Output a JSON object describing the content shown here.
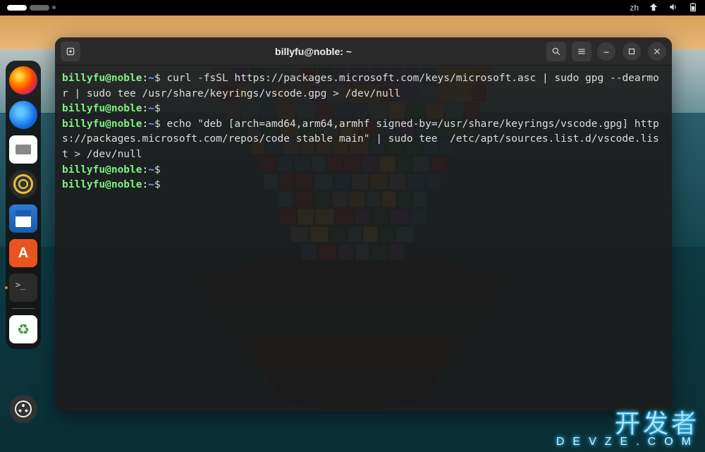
{
  "topbar": {
    "ime": "zh",
    "icons": [
      "network-icon",
      "volume-icon",
      "battery-icon"
    ]
  },
  "dock": {
    "items": [
      {
        "name": "firefox",
        "label": "Firefox"
      },
      {
        "name": "thunderbird",
        "label": "Thunderbird"
      },
      {
        "name": "files",
        "label": "Files"
      },
      {
        "name": "music",
        "label": "Rhythmbox"
      },
      {
        "name": "writer",
        "label": "LibreOffice Writer"
      },
      {
        "name": "software",
        "label": "Ubuntu Software"
      },
      {
        "name": "terminal",
        "label": "Terminal",
        "active": true
      },
      {
        "name": "trash",
        "label": "Trash"
      }
    ],
    "apps_button": "Show Applications"
  },
  "terminal": {
    "title": "billyfu@noble: ~",
    "buttons": {
      "new_tab": "New Tab",
      "search": "Search",
      "menu": "Menu",
      "minimize": "Minimize",
      "maximize": "Maximize",
      "close": "Close"
    },
    "prompt": {
      "userhost": "billyfu@noble",
      "sep": ":",
      "path": "~",
      "symbol": "$"
    },
    "lines": [
      {
        "type": "cmd",
        "text": "curl -fsSL https://packages.microsoft.com/keys/microsoft.asc | sudo gpg --dearmor | sudo tee /usr/share/keyrings/vscode.gpg > /dev/null"
      },
      {
        "type": "empty"
      },
      {
        "type": "cmd",
        "text": "echo \"deb [arch=amd64,arm64,armhf signed-by=/usr/share/keyrings/vscode.gpg] https://packages.microsoft.com/repos/code stable main\" | sudo tee  /etc/apt/sources.list.d/vscode.list > /dev/null"
      },
      {
        "type": "empty"
      },
      {
        "type": "empty"
      }
    ]
  },
  "watermark": {
    "line1": "开发者",
    "line2": "DEVZE.COM"
  }
}
